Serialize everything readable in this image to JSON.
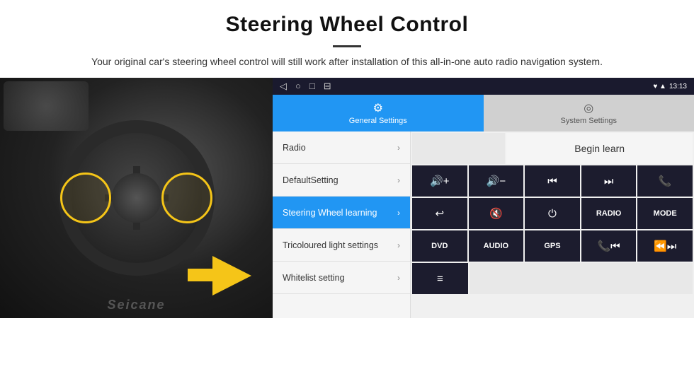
{
  "header": {
    "title": "Steering Wheel Control",
    "subtitle": "Your original car's steering wheel control will still work after installation of this all-in-one auto radio navigation system."
  },
  "android": {
    "statusbar": {
      "time": "13:13",
      "nav_icons": [
        "◁",
        "○",
        "□",
        "⊟"
      ],
      "signal_icons": "♥ ▲"
    },
    "tabs": [
      {
        "label": "General Settings",
        "icon": "⚙",
        "active": true
      },
      {
        "label": "System Settings",
        "icon": "◎",
        "active": false
      }
    ],
    "menu_items": [
      {
        "label": "Radio",
        "active": false
      },
      {
        "label": "DefaultSetting",
        "active": false
      },
      {
        "label": "Steering Wheel learning",
        "active": true
      },
      {
        "label": "Tricoloured light settings",
        "active": false
      },
      {
        "label": "Whitelist setting",
        "active": false
      }
    ],
    "buttons": {
      "begin_learn": "Begin learn",
      "row1": [
        "🔊+",
        "🔊−",
        "⏮",
        "⏭",
        "📞"
      ],
      "row2": [
        "↩",
        "🔊×",
        "⏻",
        "RADIO",
        "MODE"
      ],
      "row3": [
        "DVD",
        "AUDIO",
        "GPS",
        "📞⏮",
        "⏪⏭"
      ],
      "row4": [
        "≡"
      ]
    }
  },
  "watermark": "Seicane"
}
